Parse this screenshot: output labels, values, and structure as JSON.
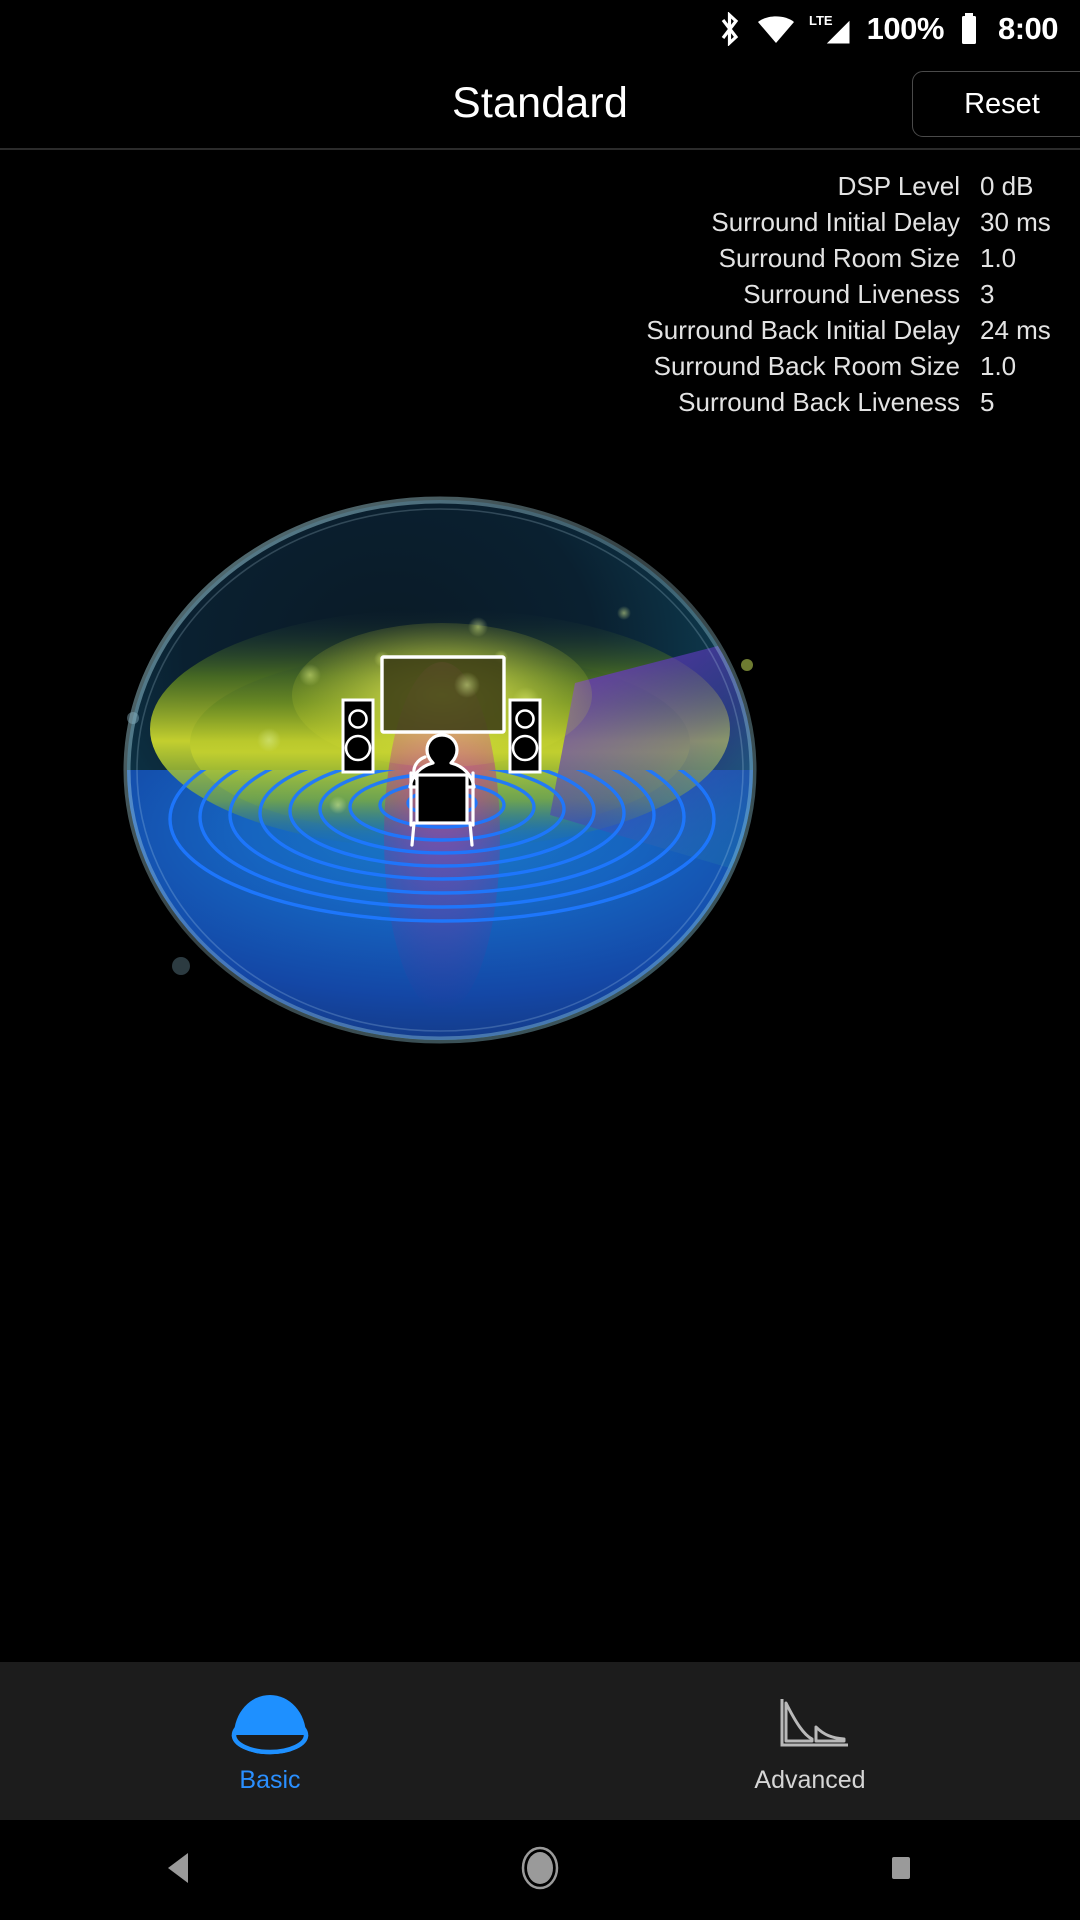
{
  "status_bar": {
    "icons": [
      "bluetooth-icon",
      "wifi-icon",
      "lte-signal-icon",
      "battery-icon"
    ],
    "lte_label": "LTE",
    "battery_text": "100%",
    "clock": "8:00"
  },
  "header": {
    "title": "Standard",
    "reset_label": "Reset"
  },
  "params": {
    "rows": [
      {
        "label": "DSP Level",
        "value": "0 dB"
      },
      {
        "label": "Surround Initial Delay",
        "value": "30 ms"
      },
      {
        "label": "Surround Room Size",
        "value": "1.0"
      },
      {
        "label": "Surround Liveness",
        "value": "3"
      },
      {
        "label": "Surround Back Initial Delay",
        "value": "24 ms"
      },
      {
        "label": "Surround Back Room Size",
        "value": "1.0"
      },
      {
        "label": "Surround Back Liveness",
        "value": "5"
      }
    ]
  },
  "visual": {
    "name": "sound-field-dome-illustration",
    "elements": [
      "dome",
      "tv-screen",
      "left-speaker",
      "right-speaker",
      "listener-in-chair",
      "sound-ripples"
    ],
    "colors": {
      "dome_top": "#0b2233",
      "dome_band": "#c9d62a",
      "dome_floor": "#1769d6",
      "ripple": "#1e78ff",
      "wedge": "#6b2fb5",
      "bass_glow": "#d0399b"
    }
  },
  "tabs": {
    "items": [
      {
        "id": "basic",
        "label": "Basic",
        "icon": "dome-icon",
        "active": true,
        "color": "#2a8fff"
      },
      {
        "id": "advanced",
        "label": "Advanced",
        "icon": "decay-curve-icon",
        "active": false,
        "color": "#d6d6d6"
      }
    ]
  },
  "nav_bar": {
    "buttons": [
      {
        "id": "back",
        "icon": "back-triangle-icon"
      },
      {
        "id": "home",
        "icon": "home-circle-icon"
      },
      {
        "id": "recents",
        "icon": "recents-square-icon"
      }
    ]
  }
}
